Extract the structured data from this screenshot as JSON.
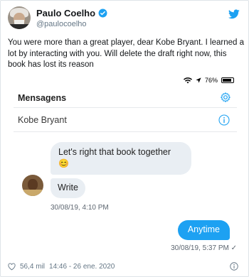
{
  "tweet": {
    "author_name": "Paulo Coelho",
    "handle": "@paulocoelho",
    "text": "You were more than a great player, dear Kobe Bryant. I learned a lot by interacting with you. Will delete the draft right now, this book has lost its reason",
    "likes": "56,4 mil",
    "timestamp": "14:46 - 26 ene. 2020"
  },
  "screenshot": {
    "status": {
      "battery": "76%"
    },
    "title": "Mensagens",
    "contact": "Kobe Bryant",
    "messages": [
      {
        "text": "Let's right that book together",
        "emoji": "😊"
      },
      {
        "text": "Write"
      }
    ],
    "time_in": "30/08/19, 4:10 PM",
    "reply": "Anytime",
    "time_out": "30/08/19, 5:37 PM ✓"
  },
  "colors": {
    "accent": "#1da1f2",
    "bubble_in": "#e9eef3",
    "muted": "#657786"
  }
}
